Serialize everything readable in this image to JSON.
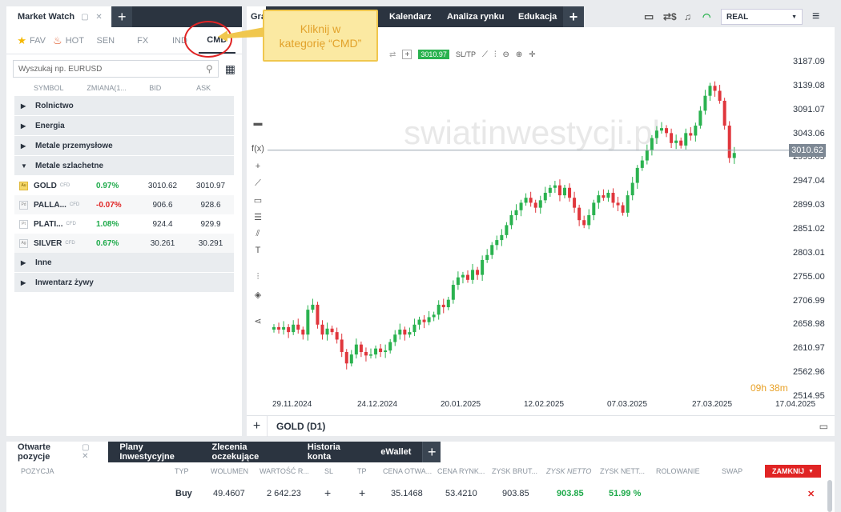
{
  "left_panel": {
    "tab_title": "Market Watch",
    "categories": [
      {
        "label": "FAV",
        "icon": "star-icon"
      },
      {
        "label": "HOT",
        "icon": "fire-icon"
      },
      {
        "label": "SEN",
        "icon": ""
      },
      {
        "label": "FX",
        "icon": ""
      },
      {
        "label": "IND",
        "icon": ""
      },
      {
        "label": "CMD",
        "icon": ""
      }
    ],
    "search_placeholder": "Wyszukaj np. EURUSD",
    "columns": [
      "SYMBOL",
      "ZMIANA(1...",
      "BID",
      "ASK"
    ],
    "groups_before": [
      "Rolnictwo",
      "Energia",
      "Metale przemysłowe"
    ],
    "open_group": "Metale szlachetne",
    "instruments": [
      {
        "symbol": "GOLD",
        "icon_text": "Au",
        "tag": "CFD",
        "change": "0.97%",
        "dir": "up",
        "bid": "3010.62",
        "ask": "3010.97"
      },
      {
        "symbol": "PALLA...",
        "icon_text": "Pd",
        "tag": "CFD",
        "change": "-0.07%",
        "dir": "down",
        "bid": "906.6",
        "ask": "928.6"
      },
      {
        "symbol": "PLATI...",
        "icon_text": "Pt",
        "tag": "CFD",
        "change": "1.08%",
        "dir": "up",
        "bid": "924.4",
        "ask": "929.9"
      },
      {
        "symbol": "SILVER",
        "icon_text": "Ag",
        "tag": "CFD",
        "change": "0.67%",
        "dir": "up",
        "bid": "30.261",
        "ask": "30.291"
      }
    ],
    "groups_after": [
      "Inne",
      "Inwentarz żywy"
    ]
  },
  "top_tabs": {
    "chart_tab": "Gra",
    "calendar": "Kalendarz",
    "analysis": "Analiza rynku",
    "education": "Edukacja",
    "account_mode": "REAL"
  },
  "chart_toolbar": {
    "price_badge": "3010.97",
    "sltp": "SL/TP"
  },
  "callout": {
    "line1": "Kliknij w",
    "line2": "kategorię “CMD”"
  },
  "watermark": "swiatinwestycji.pl",
  "chart_footer": {
    "symbol": "GOLD (D1)",
    "countdown_h": "09h",
    "countdown_m": "38m"
  },
  "chart_data": {
    "type": "candlestick",
    "instrument": "GOLD",
    "timeframe": "D1",
    "y_ticks": [
      "3187.09",
      "3139.08",
      "3091.07",
      "3043.06",
      "2995.05",
      "2947.04",
      "2899.03",
      "2851.02",
      "2803.01",
      "2755.00",
      "2706.99",
      "2658.98",
      "2610.97",
      "2562.96",
      "2514.95"
    ],
    "x_ticks": [
      "29.11.2024",
      "24.12.2024",
      "20.01.2025",
      "12.02.2025",
      "07.03.2025",
      "27.03.2025",
      "17.04.2025"
    ],
    "current_price": "3010.62",
    "ylim": [
      2514.95,
      3187.09
    ],
    "closes": [
      2655,
      2650,
      2655,
      2645,
      2660,
      2650,
      2640,
      2690,
      2700,
      2660,
      2640,
      2652,
      2645,
      2630,
      2605,
      2582,
      2600,
      2620,
      2605,
      2598,
      2600,
      2612,
      2605,
      2608,
      2625,
      2640,
      2650,
      2640,
      2645,
      2660,
      2670,
      2665,
      2675,
      2680,
      2700,
      2695,
      2710,
      2740,
      2755,
      2760,
      2750,
      2770,
      2760,
      2790,
      2800,
      2820,
      2830,
      2840,
      2860,
      2880,
      2890,
      2905,
      2915,
      2905,
      2895,
      2910,
      2925,
      2935,
      2940,
      2920,
      2935,
      2915,
      2895,
      2870,
      2860,
      2880,
      2905,
      2920,
      2915,
      2925,
      2905,
      2900,
      2885,
      2920,
      2945,
      2975,
      2990,
      3010,
      3035,
      3050,
      3055,
      3045,
      3025,
      3030,
      3020,
      3045,
      3040,
      3060,
      3090,
      3120,
      3140,
      3130,
      3110,
      3060,
      2995,
      3005
    ]
  },
  "bottom_panel": {
    "tab_title": "Otwarte pozycje",
    "tabs": [
      "Plany Inwestycyjne",
      "Zlecenia oczekujące",
      "Historia konta",
      "eWallet"
    ],
    "columns": [
      "POZYCJA",
      "TYP",
      "WOLUMEN",
      "WARTOŚĆ R...",
      "SL",
      "TP",
      "CENA OTWA...",
      "CENA RYNK...",
      "ZYSK BRUT...",
      "ZYSK NETTO",
      "ZYSK NETT...",
      "ROLOWANIE",
      "SWAP"
    ],
    "close_button": "ZAMKNIJ",
    "position": {
      "type": "Buy",
      "volume": "49.4607",
      "value": "2 642.23",
      "open_price": "35.1468",
      "market_price": "53.4210",
      "gross": "903.85",
      "net": "903.85",
      "net_pct": "51.99 %"
    }
  }
}
